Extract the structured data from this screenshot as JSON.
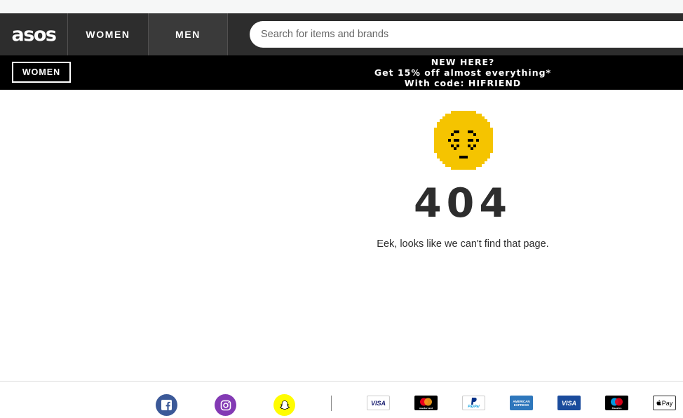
{
  "header": {
    "logo": "asos",
    "nav": [
      {
        "label": "WOMEN"
      },
      {
        "label": "MEN"
      }
    ],
    "search": {
      "placeholder": "Search for items and brands"
    }
  },
  "promo": {
    "button_label": "WOMEN",
    "line1": "NEW HERE?",
    "line2": "Get 15% off almost everything*",
    "line3": "With code: HIFRIEND"
  },
  "error": {
    "code": "404",
    "message": "Eek, looks like we can't find that page."
  },
  "footer": {
    "social_icons": [
      "facebook-icon",
      "instagram-icon",
      "snapchat-icon"
    ],
    "payment_methods": [
      {
        "icon": "visa-icon",
        "label": "VISA"
      },
      {
        "icon": "mastercard-icon",
        "label": "mastercard"
      },
      {
        "icon": "paypal-icon",
        "label": "PayPal"
      },
      {
        "icon": "american-express-icon",
        "label": "AMERICAN EXPRESS"
      },
      {
        "icon": "visa-electron-icon",
        "label": "VISA"
      },
      {
        "icon": "maestro-icon",
        "label": "Maestro"
      },
      {
        "icon": "apple-pay-icon",
        "label": "Pay"
      }
    ]
  },
  "colors": {
    "header_bg": "#2d2d2d",
    "promo_bg": "#000000",
    "face_yellow": "#f5c400",
    "text": "#2d2d2d"
  }
}
